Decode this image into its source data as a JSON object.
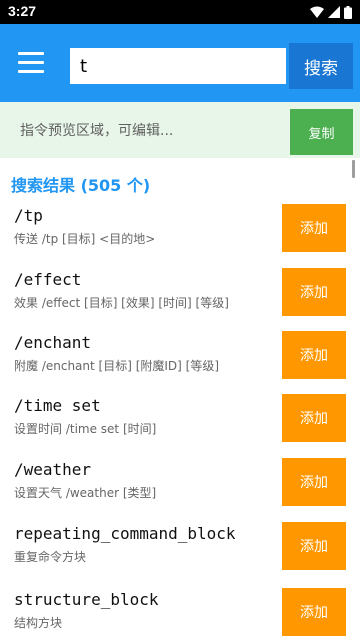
{
  "status": {
    "time": "3:27"
  },
  "search": {
    "value": "t",
    "button_label": "搜索"
  },
  "preview": {
    "placeholder": "指令预览区域，可编辑...",
    "copy_label": "复制"
  },
  "results": {
    "header": "搜索结果 (505 个)",
    "add_label": "添加",
    "items": [
      {
        "name": "/tp",
        "desc": "传送 /tp [目标] <目的地>"
      },
      {
        "name": "/effect",
        "desc": "效果 /effect [目标] [效果] [时间] [等级]"
      },
      {
        "name": "/enchant",
        "desc": "附魔 /enchant [目标] [附魔ID] [等级]"
      },
      {
        "name": "/time set",
        "desc": "设置时间 /time set [时间]"
      },
      {
        "name": "/weather",
        "desc": "设置天气 /weather [类型]"
      },
      {
        "name": "repeating_command_block",
        "desc": "重复命令方块"
      },
      {
        "name": "structure_block",
        "desc": "结构方块"
      }
    ]
  },
  "colors": {
    "app_bar": "#2196f3",
    "search_button": "#1976d2",
    "copy_button": "#4caf50",
    "add_button": "#ff9800",
    "preview_bg": "#e8f5e9"
  },
  "icons": {
    "menu": "menu-icon",
    "wifi": "wifi-icon",
    "signal": "signal-icon",
    "battery": "battery-icon"
  }
}
